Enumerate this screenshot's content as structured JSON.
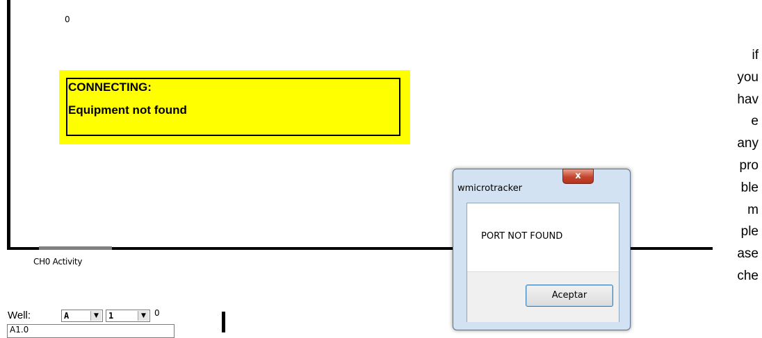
{
  "chart": {
    "zero_label": "0",
    "channel_label": "CH0 Activity",
    "status": {
      "line1": "CONNECTING:",
      "line2": "Equipment not found",
      "background": "#ffff00"
    }
  },
  "well": {
    "label": "Well:",
    "row_value": "A",
    "col_value": "1",
    "count": "0",
    "list_item": "A1.0"
  },
  "dialog": {
    "title": "wmicrotracker",
    "close_glyph": "x",
    "message": "PORT NOT FOUND",
    "ok_label": "Aceptar"
  },
  "side_text": {
    "lines": [
      "if",
      "you",
      "hav",
      "e",
      "any",
      "pro",
      "ble",
      "m",
      "ple",
      "ase",
      "che"
    ]
  }
}
